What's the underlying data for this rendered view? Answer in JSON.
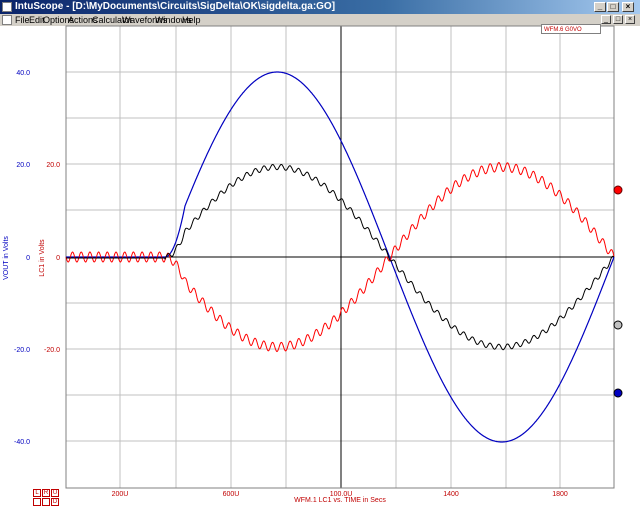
{
  "window": {
    "title": "IntuScope - [D:\\MyDocuments\\Circuits\\SigDelta\\OK\\sigdelta.ga:GO]",
    "min_glyph": "_",
    "max_glyph": "□",
    "close_glyph": "×"
  },
  "menu": [
    "File",
    "Edit",
    "Options",
    "Actions",
    "Calculator",
    "Waveforms",
    "Windows",
    "Help"
  ],
  "legend_box": "WFM.6 G0VO",
  "plot": {
    "left_axis_title": "VOUT in Volts",
    "right_axis_title": "LC1 in Volts",
    "x_axis_title": "WFM.1  LC1 vs. TIME in Secs",
    "y_ticks_blue": [
      "40.0",
      "20.0",
      "0",
      "-20.0",
      "-40.0"
    ],
    "y_ticks_red": [
      "20.0",
      "0",
      "-20.0"
    ],
    "x_ticks": [
      "200U",
      "600U",
      "100.0U",
      "1400",
      "1800"
    ],
    "zoom_buttons": [
      "L",
      "R",
      "U",
      "D"
    ],
    "colors": {
      "vout": "#0000c0",
      "lc1": "#ff0000",
      "filtered": "#000000",
      "grid": "#c0c0c0",
      "axis": "#000000",
      "tick_blue": "#0000c0",
      "tick_red": "#c00000"
    },
    "markers": {
      "red": "#ff0000",
      "black": "#808080",
      "blue": "#0000c0"
    }
  }
}
